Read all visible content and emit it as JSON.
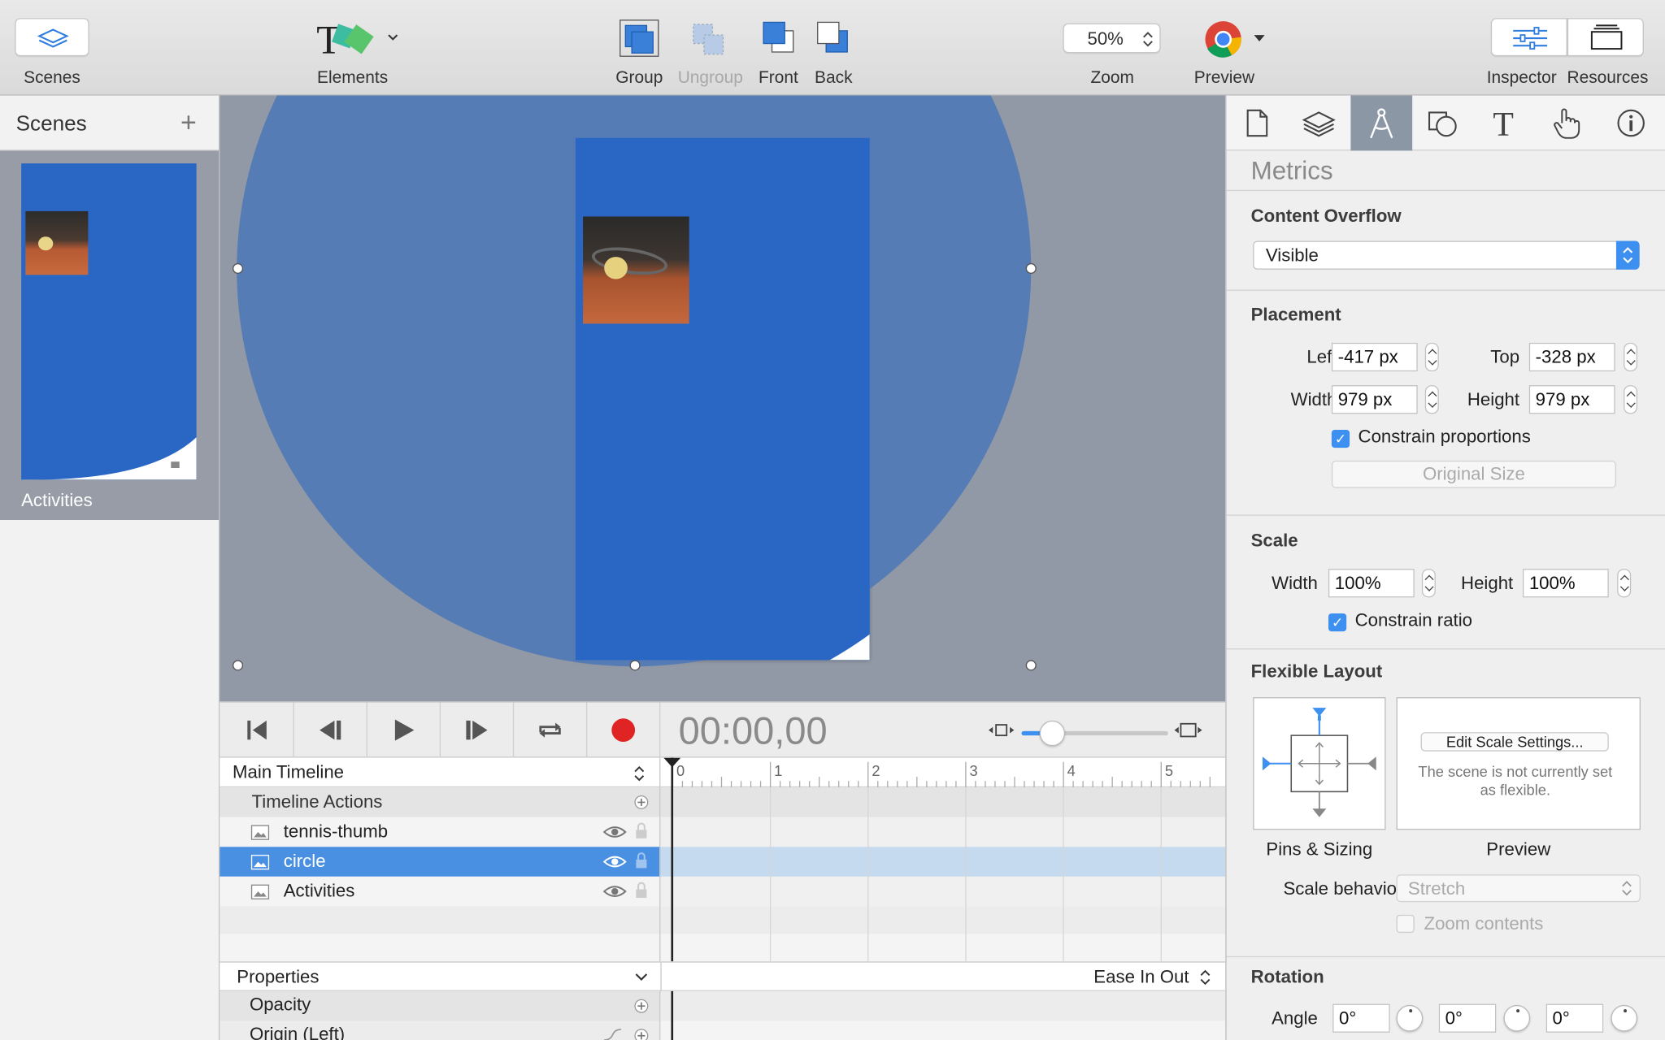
{
  "toolbar": {
    "scenes_label": "Scenes",
    "elements_label": "Elements",
    "group_label": "Group",
    "ungroup_label": "Ungroup",
    "front_label": "Front",
    "back_label": "Back",
    "zoom_value": "50%",
    "zoom_label": "Zoom",
    "preview_label": "Preview",
    "inspector_label": "Inspector",
    "resources_label": "Resources"
  },
  "scenes": {
    "title": "Scenes",
    "items": [
      {
        "label": "Activities"
      }
    ]
  },
  "timeline": {
    "time": "00:00,00",
    "main_timeline": "Main Timeline",
    "timeline_actions": "Timeline Actions",
    "elements": [
      {
        "label": "tennis-thumb",
        "selected": false
      },
      {
        "label": "circle",
        "selected": true
      },
      {
        "label": "Activities",
        "selected": false
      }
    ],
    "ruler_ticks": [
      "0",
      "1",
      "2",
      "3",
      "4",
      "5"
    ],
    "properties": "Properties",
    "easing": "Ease In Out",
    "property_rows": [
      "Opacity",
      "Origin (Left)"
    ]
  },
  "inspector": {
    "metrics_title": "Metrics",
    "content_overflow": {
      "label": "Content Overflow",
      "value": "Visible"
    },
    "placement": {
      "label": "Placement",
      "left_label": "Left",
      "left": "-417 px",
      "top_label": "Top",
      "top": "-328 px",
      "width_label": "Width",
      "width": "979 px",
      "height_label": "Height",
      "height": "979 px",
      "constrain": "Constrain proportions",
      "original_size": "Original Size"
    },
    "scale": {
      "label": "Scale",
      "width_label": "Width",
      "width": "100%",
      "height_label": "Height",
      "height": "100%",
      "constrain": "Constrain ratio"
    },
    "flexible": {
      "label": "Flexible Layout",
      "edit_button": "Edit Scale Settings...",
      "note": "The scene is not currently set as flexible.",
      "pins_label": "Pins & Sizing",
      "preview_label": "Preview",
      "scale_behavior_label": "Scale behavior",
      "scale_behavior_value": "Stretch",
      "zoom_contents": "Zoom contents"
    },
    "rotation": {
      "label": "Rotation",
      "angle_label": "Angle",
      "values": [
        "0°",
        "0°",
        "0°"
      ]
    }
  },
  "colors": {
    "accent": "#3d8ff0",
    "scene_blue": "#2a67c4",
    "circle": "#5a7fb4",
    "canvas_bg": "#9199a6",
    "selection": "#4a90e2"
  }
}
